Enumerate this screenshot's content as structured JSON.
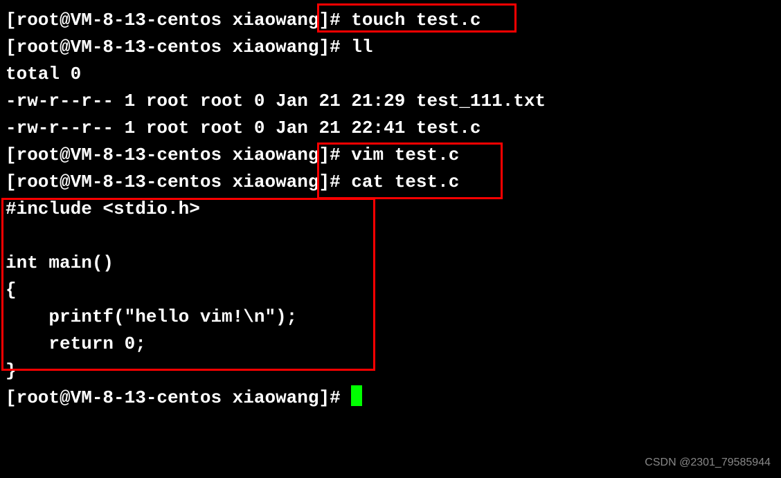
{
  "prompt": "[root@VM-8-13-centos xiaowang]# ",
  "lines": {
    "l1_cmd": "touch test.c",
    "l2_cmd": "ll",
    "l3": "total 0",
    "l4": "-rw-r--r-- 1 root root 0 Jan 21 21:29 test_111.txt",
    "l5": "-rw-r--r-- 1 root root 0 Jan 21 22:41 test.c",
    "l6_cmd": "vim test.c",
    "l7_cmd": "cat test.c",
    "code1": "#include <stdio.h>",
    "code2": "",
    "code3": "int main()",
    "code4": "{",
    "code5": "    printf(\"hello vim!\\n\");",
    "code6": "    return 0;",
    "code7": "}"
  },
  "watermark": "CSDN @2301_79585944"
}
